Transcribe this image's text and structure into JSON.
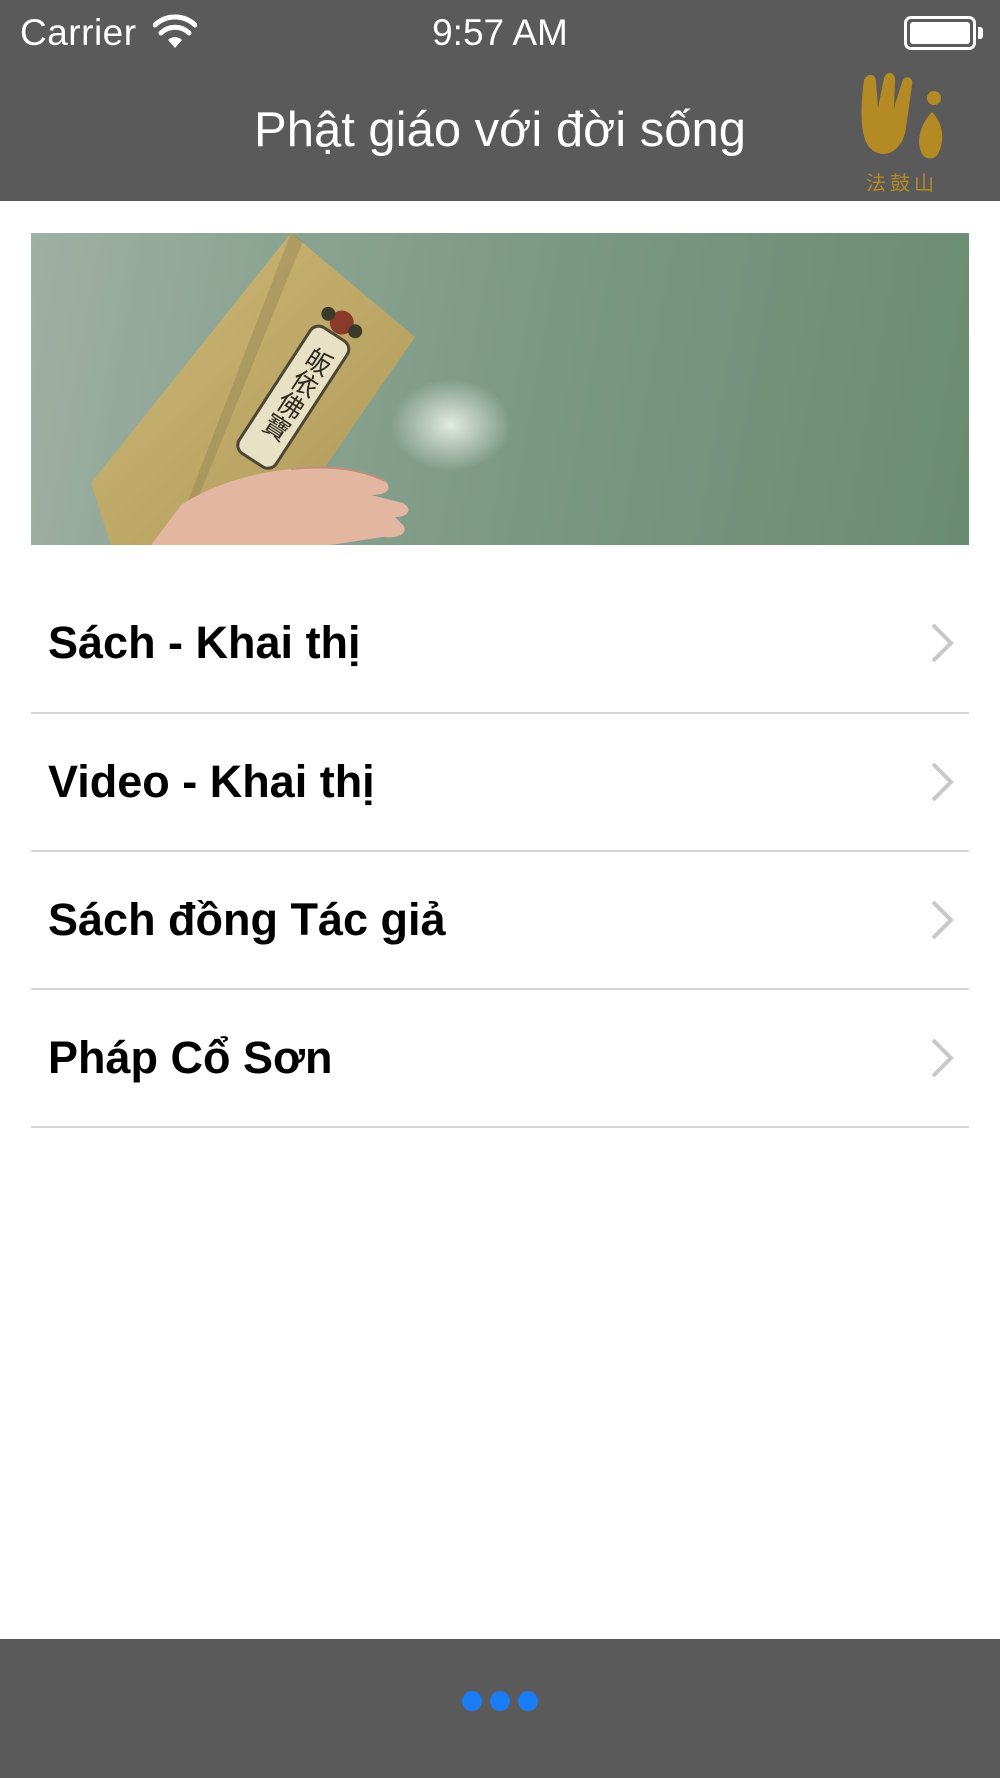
{
  "status_bar": {
    "carrier": "Carrier",
    "wifi_icon": "wifi-icon",
    "time": "9:57 AM",
    "battery_icon": "battery-icon"
  },
  "nav_bar": {
    "title": "Phật giáo với đời sống",
    "logo_icon": "dharma-drum-logo",
    "logo_text": "法鼓山"
  },
  "banner": {
    "image": "hand-holding-book-photo",
    "book_text": "皈依佛寶",
    "accent_color": "#c2a862"
  },
  "menu": {
    "items": [
      {
        "label": "Sách -  Khai thị"
      },
      {
        "label": "Video - Khai thị"
      },
      {
        "label": "Sách đồng Tác giả"
      },
      {
        "label": "Pháp Cổ Sơn"
      }
    ],
    "chevron_icon": "chevron-right-icon"
  },
  "bottom_bar": {
    "more_icon": "more-dots-icon",
    "dot_color": "#1a7cf5"
  }
}
